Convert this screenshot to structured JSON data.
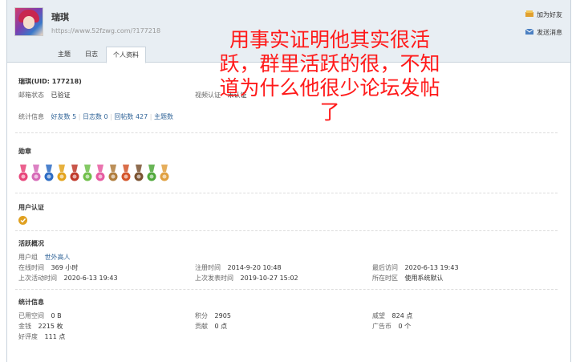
{
  "header": {
    "username": "瑞琪",
    "url": "https://www.52fzwg.com/?177218",
    "add_friend": "加为好友",
    "send_message": "发送消息",
    "tabs": [
      {
        "label": "主题"
      },
      {
        "label": "日志"
      },
      {
        "label": "个人资料"
      }
    ]
  },
  "profile": {
    "uid_line": "瑞琪(UID: 177218)",
    "email_label": "邮箱状态",
    "email_value": "已验证",
    "video_label": "视频认证",
    "video_value": "未认证",
    "stats_label": "统计信息",
    "friends": "好友数 5",
    "blogs": "日志数 0",
    "replies": "回帖数 427",
    "threads": "主题数"
  },
  "medals": {
    "title": "勋章",
    "colors": [
      "#e8457a",
      "#d66bb8",
      "#2d6cc4",
      "#e3a31c",
      "#c0392b",
      "#6fbf4a",
      "#e65aa0",
      "#b07d3c",
      "#d4552a",
      "#7a5230",
      "#4fa83a",
      "#e0a040"
    ]
  },
  "verification": {
    "title": "用户认证",
    "badge_icon": "verified-badge-icon"
  },
  "activity": {
    "title": "活跃概况",
    "group_label": "用户组",
    "group_value": "世外高人",
    "online_label": "在线时间",
    "online_value": "369 小时",
    "register_label": "注册时间",
    "register_value": "2014-9-20 10:48",
    "last_visit_label": "最后访问",
    "last_visit_value": "2020-6-13 19:43",
    "last_active_label": "上次活动时间",
    "last_active_value": "2020-6-13 19:43",
    "last_post_label": "上次发表时间",
    "last_post_value": "2019-10-27 15:02",
    "timezone_label": "所在时区",
    "timezone_value": "使用系统默认"
  },
  "stats": {
    "title": "统计信息",
    "space_label": "已用空间",
    "space_value": "0 B",
    "points_label": "积分",
    "points_value": "2905",
    "prestige_label": "威望",
    "prestige_value": "824 点",
    "money_label": "金钱",
    "money_value": "2215 枚",
    "contribution_label": "贡献",
    "contribution_value": "0 点",
    "ad_coin_label": "广告币",
    "ad_coin_value": "0 个",
    "rating_label": "好评度",
    "rating_value": "111 点"
  },
  "overlay": {
    "text": "用事实证明他其实很活\n跃，群里活跃的很，不知\n道为什么他很少论坛发帖\n了"
  }
}
